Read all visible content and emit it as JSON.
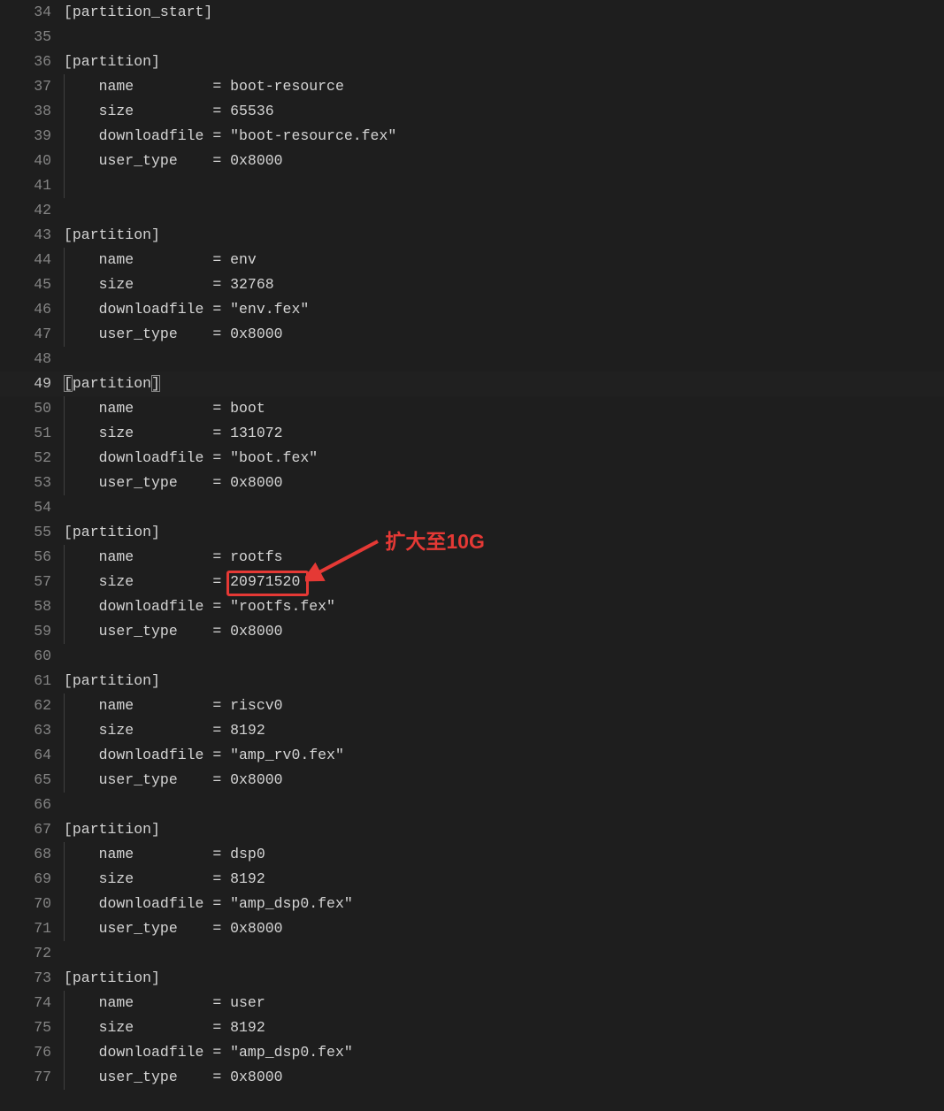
{
  "annotation": {
    "label": "扩大至10G",
    "color": "#e53935"
  },
  "highlight_line": 49,
  "boxed_value": {
    "line": 57,
    "text": "20971520"
  },
  "lines": [
    {
      "num": 34,
      "indent": 0,
      "text": "[partition_start]"
    },
    {
      "num": 35,
      "indent": 0,
      "text": ""
    },
    {
      "num": 36,
      "indent": 0,
      "text": "[partition]"
    },
    {
      "num": 37,
      "indent": 1,
      "key": "name",
      "val": "boot-resource"
    },
    {
      "num": 38,
      "indent": 1,
      "key": "size",
      "val": "65536"
    },
    {
      "num": 39,
      "indent": 1,
      "key": "downloadfile",
      "val": "\"boot-resource.fex\""
    },
    {
      "num": 40,
      "indent": 1,
      "key": "user_type",
      "val": "0x8000"
    },
    {
      "num": 41,
      "indent": 1,
      "text": ""
    },
    {
      "num": 42,
      "indent": 0,
      "text": ""
    },
    {
      "num": 43,
      "indent": 0,
      "text": "[partition]"
    },
    {
      "num": 44,
      "indent": 1,
      "key": "name",
      "val": "env"
    },
    {
      "num": 45,
      "indent": 1,
      "key": "size",
      "val": "32768"
    },
    {
      "num": 46,
      "indent": 1,
      "key": "downloadfile",
      "val": "\"env.fex\""
    },
    {
      "num": 47,
      "indent": 1,
      "key": "user_type",
      "val": "0x8000"
    },
    {
      "num": 48,
      "indent": 0,
      "text": ""
    },
    {
      "num": 49,
      "indent": 0,
      "text": "[partition]",
      "current": true,
      "bracket": true
    },
    {
      "num": 50,
      "indent": 1,
      "key": "name",
      "val": "boot"
    },
    {
      "num": 51,
      "indent": 1,
      "key": "size",
      "val": "131072"
    },
    {
      "num": 52,
      "indent": 1,
      "key": "downloadfile",
      "val": "\"boot.fex\""
    },
    {
      "num": 53,
      "indent": 1,
      "key": "user_type",
      "val": "0x8000"
    },
    {
      "num": 54,
      "indent": 0,
      "text": ""
    },
    {
      "num": 55,
      "indent": 0,
      "text": "[partition]"
    },
    {
      "num": 56,
      "indent": 1,
      "key": "name",
      "val": "rootfs"
    },
    {
      "num": 57,
      "indent": 1,
      "key": "size",
      "val": "20971520",
      "boxed": true
    },
    {
      "num": 58,
      "indent": 1,
      "key": "downloadfile",
      "val": "\"rootfs.fex\""
    },
    {
      "num": 59,
      "indent": 1,
      "key": "user_type",
      "val": "0x8000"
    },
    {
      "num": 60,
      "indent": 0,
      "text": ""
    },
    {
      "num": 61,
      "indent": 0,
      "text": "[partition]"
    },
    {
      "num": 62,
      "indent": 1,
      "key": "name",
      "val": "riscv0"
    },
    {
      "num": 63,
      "indent": 1,
      "key": "size",
      "val": "8192"
    },
    {
      "num": 64,
      "indent": 1,
      "key": "downloadfile",
      "val": "\"amp_rv0.fex\""
    },
    {
      "num": 65,
      "indent": 1,
      "key": "user_type",
      "val": "0x8000"
    },
    {
      "num": 66,
      "indent": 0,
      "text": ""
    },
    {
      "num": 67,
      "indent": 0,
      "text": "[partition]"
    },
    {
      "num": 68,
      "indent": 1,
      "key": "name",
      "val": "dsp0"
    },
    {
      "num": 69,
      "indent": 1,
      "key": "size",
      "val": "8192"
    },
    {
      "num": 70,
      "indent": 1,
      "key": "downloadfile",
      "val": "\"amp_dsp0.fex\""
    },
    {
      "num": 71,
      "indent": 1,
      "key": "user_type",
      "val": "0x8000"
    },
    {
      "num": 72,
      "indent": 0,
      "text": ""
    },
    {
      "num": 73,
      "indent": 0,
      "text": "[partition]"
    },
    {
      "num": 74,
      "indent": 1,
      "key": "name",
      "val": "user"
    },
    {
      "num": 75,
      "indent": 1,
      "key": "size",
      "val": "8192"
    },
    {
      "num": 76,
      "indent": 1,
      "key": "downloadfile",
      "val": "\"amp_dsp0.fex\""
    },
    {
      "num": 77,
      "indent": 1,
      "key": "user_type",
      "val": "0x8000"
    }
  ]
}
